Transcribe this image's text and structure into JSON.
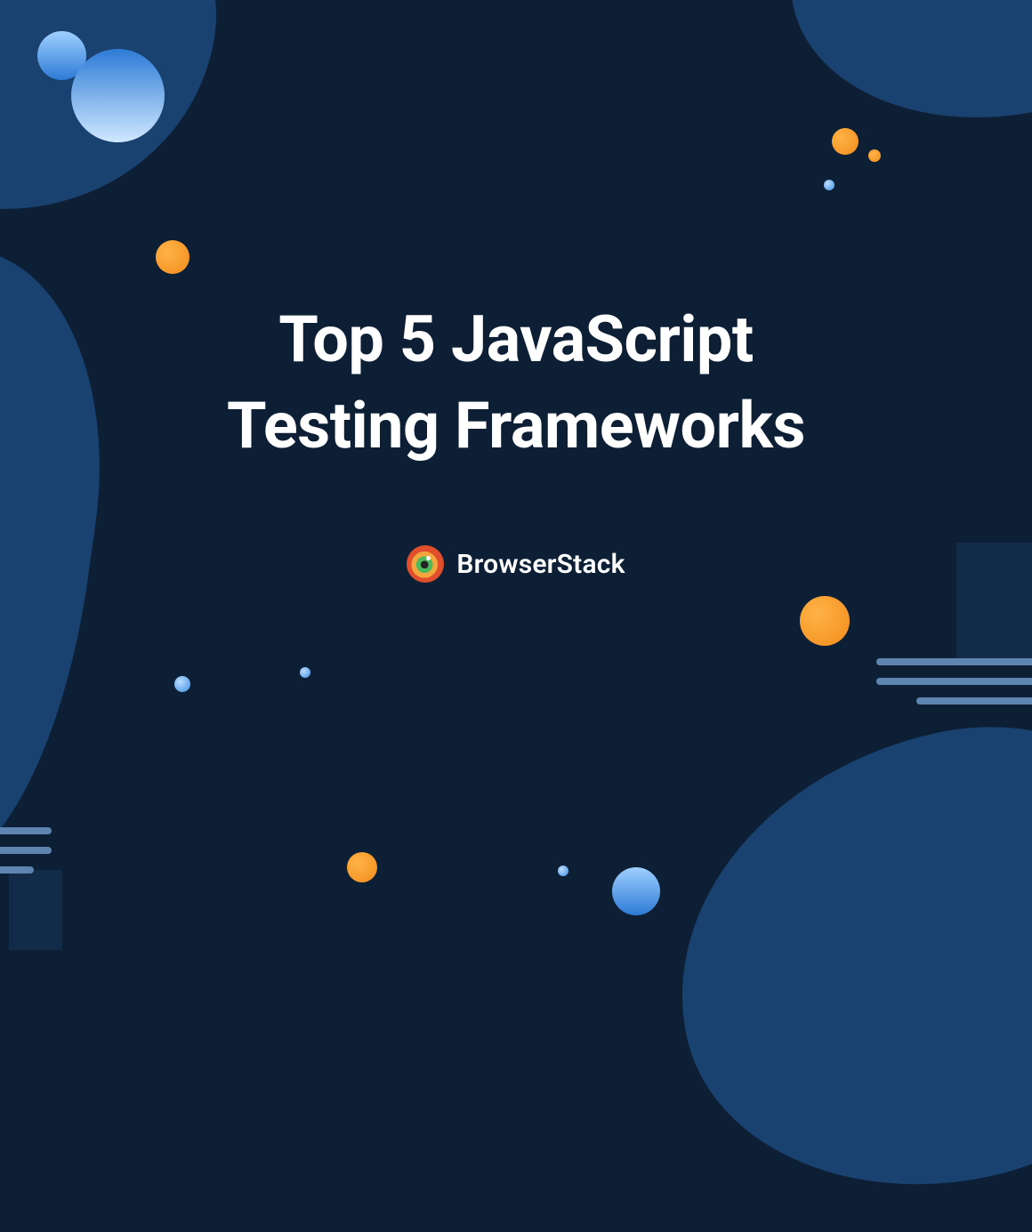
{
  "headline_line1": "Top 5 JavaScript",
  "headline_line2": "Testing Frameworks",
  "brand_name": "BrowserStack",
  "colors": {
    "background": "#0d1f35",
    "blob": "#1a4270",
    "orange": "#f28c1b",
    "blue": "#2d7bd6",
    "text": "#ffffff"
  }
}
